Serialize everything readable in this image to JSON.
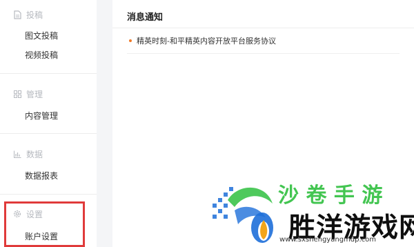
{
  "sidebar": {
    "sections": [
      {
        "title": "投稿",
        "icon": "document-icon",
        "items": [
          "图文投稿",
          "视频投稿"
        ]
      },
      {
        "title": "管理",
        "icon": "grid-icon",
        "items": [
          "内容管理"
        ]
      },
      {
        "title": "数据",
        "icon": "bar-chart-icon",
        "items": [
          "数据报表"
        ]
      },
      {
        "title": "设置",
        "icon": "gear-icon",
        "items": [
          "账户设置"
        ]
      }
    ]
  },
  "main": {
    "title": "消息通知",
    "notices": [
      "精英时刻-和平精英内容开放平台服务协议"
    ]
  },
  "watermark": {
    "brand_top": "沙 卷 手 游",
    "brand": "胜洋游戏网",
    "url": "www.sxshengyangmdp.com",
    "colors": {
      "green": "#2fbf3f",
      "blue": "#1e6fd9"
    }
  },
  "highlight_color": "#e03a3a"
}
